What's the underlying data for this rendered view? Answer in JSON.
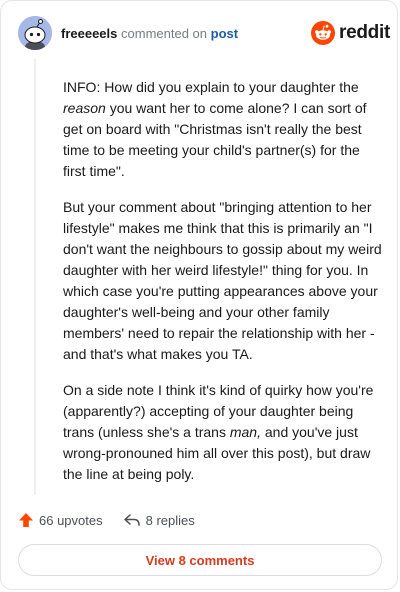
{
  "header": {
    "username": "freeeeels",
    "action_text": "commented on",
    "post_link": "post",
    "brand": "reddit"
  },
  "comment": {
    "p1_a": "INFO: How did you explain to your daughter the ",
    "p1_em": "reason",
    "p1_b": " you want her to come alone? I can sort of get on board with \"Christmas isn't really the best time to be meeting your child's partner(s) for the first time\".",
    "p2": "But your comment about \"bringing attention to her lifestyle\" makes me think that this is primarily an \"I don't want the neighbours to gossip about my weird daughter with her weird lifestyle!\" thing for you. In which case you're putting appearances above your daughter's well-being and your other family members' need to repair the relationship with her - and that's what makes you TA.",
    "p3_a": "On a side note I think it's kind of quirky how you're (apparently?) accepting of your daughter being trans (unless she's a trans ",
    "p3_em": "man,",
    "p3_b": " and you've just wrong-pronouned him all over this post), but draw the line at being poly."
  },
  "actions": {
    "upvotes": "66 upvotes",
    "replies": "8 replies"
  },
  "footer": {
    "view_comments": "View 8 comments"
  },
  "colors": {
    "upvote": "#ff4500",
    "link": "#1a5da6",
    "view_button_text": "#d63c1d",
    "avatar_bg": "#a6b8e8"
  },
  "icons": {
    "avatar": "snoo-avatar-icon",
    "brand": "reddit-logo-icon",
    "upvote": "upvote-arrow-icon",
    "reply": "reply-arrow-icon"
  }
}
